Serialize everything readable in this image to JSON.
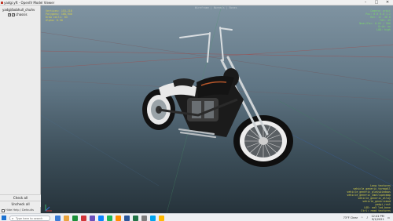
{
  "window": {
    "title": "yadgi.yft - OpenIV Model Viewer",
    "controls": [
      "–",
      "□",
      "✕"
    ]
  },
  "tree": {
    "root_label": "yadgi/bobhull_chuhv",
    "child_label": "chassis",
    "child_checked": true
  },
  "left_panel": {
    "check_all": "Check all",
    "uncheck_all": "Uncheck all",
    "status_label": "Hide Help / Defaults"
  },
  "viewport": {
    "top_info": "Wireframe | Normals | Bones",
    "hud_left": [
      "Vertices: 153,218",
      "Polygons: 108,940",
      "Draw calls: 84",
      "Alpha: 0.50"
    ],
    "hud_right": [
      "Camera: orbit",
      "Pos: 0.0 0.0 1.2",
      "Rot: 12 -38 0",
      "FOV: 45",
      "Near/Far: 0.01 / 500",
      "Grid: on",
      "LOD: high"
    ],
    "hud_bottom_right": [
      "Long textures",
      "vehicle_generic_tyrewall",
      "vehicle_generic_glasswindows",
      "vehicle_generic_smallspecmap",
      "vehicle_generic_alloy",
      "vehicle_genericmud",
      "yadgi_rust",
      "LOD: aa5 lod_bone",
      "Ctrl: read textures"
    ]
  },
  "taskbar": {
    "search_placeholder": "Type here to search",
    "weather": "73°F Clear",
    "time": "12:41 PM",
    "date": "9/1/2021",
    "icon_colors": [
      "#3a7bd5",
      "#e8a33d",
      "#1b8f3a",
      "#d13438",
      "#6b4fbb",
      "#0a84ff",
      "#1db954",
      "#ff8c00",
      "#2b579a",
      "#217346",
      "#7d7d7d",
      "#00a4ef",
      "#ffb900"
    ]
  },
  "colors": {
    "viewport_sky": "#7f93a1",
    "grid_red": "#c0392b",
    "grid_green": "#3cb371",
    "grid_blue": "#3a6fd6",
    "hud_yellow": "#d8d24a",
    "hud_green": "#7bd66a"
  }
}
